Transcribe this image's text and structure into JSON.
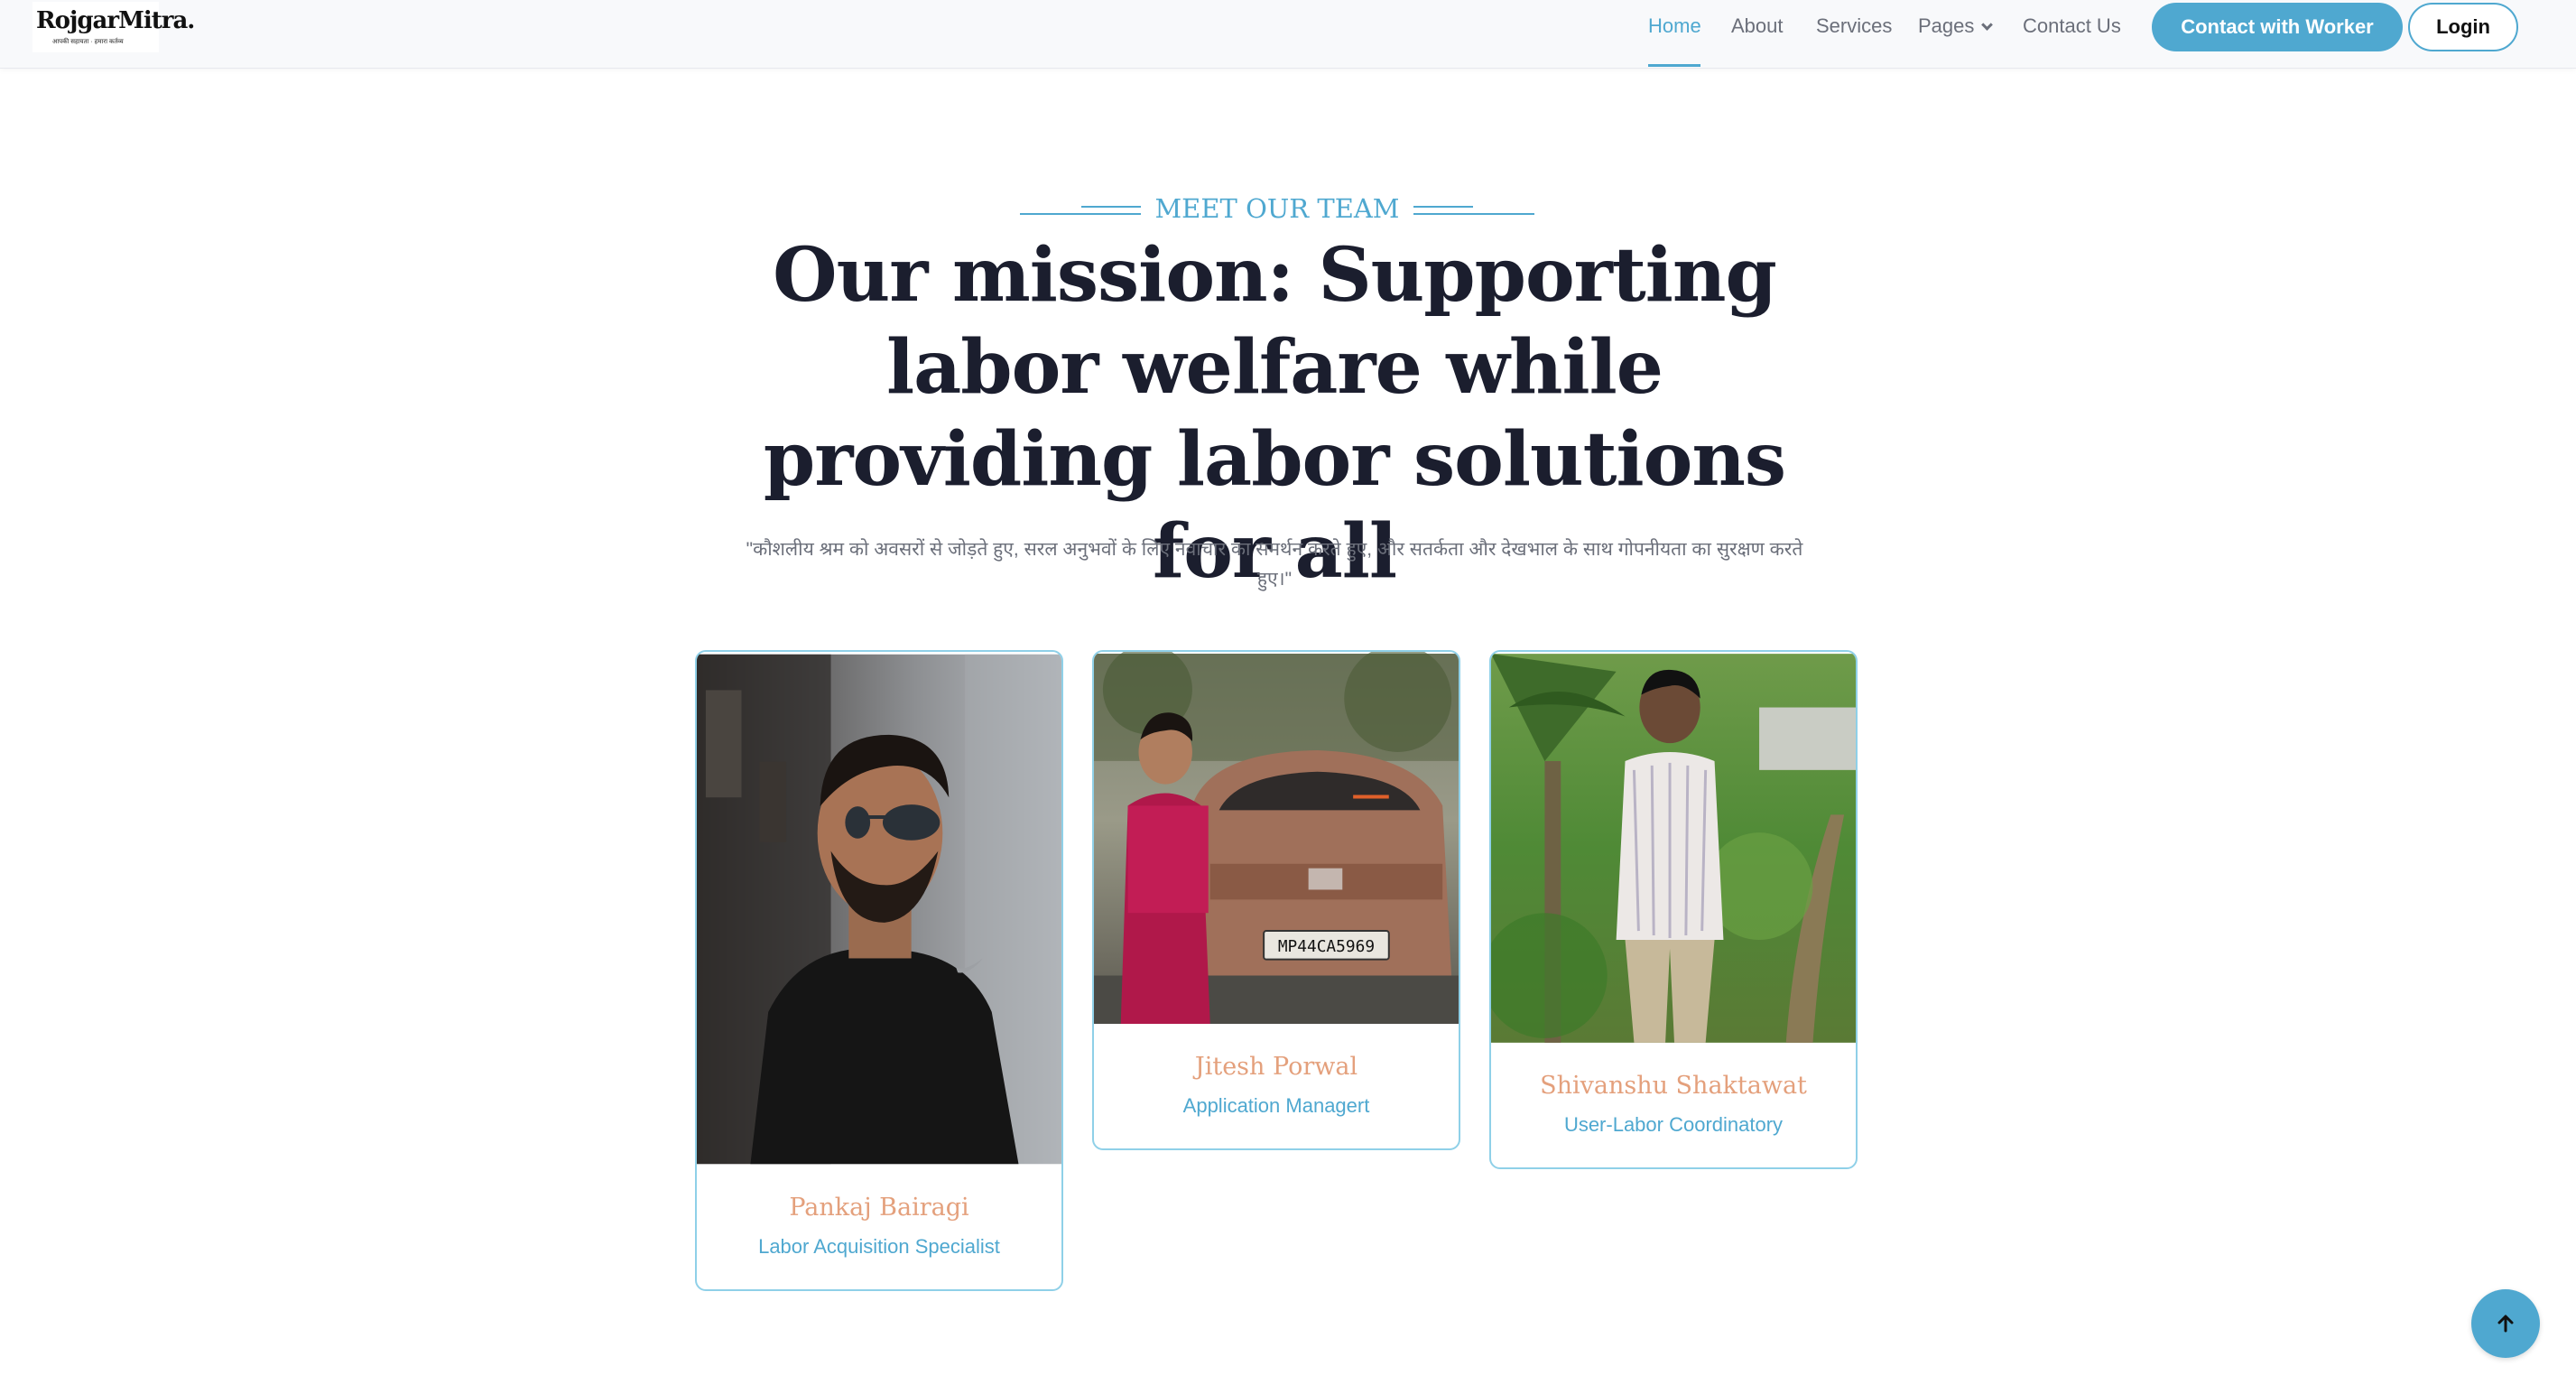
{
  "logo": {
    "title": "RojgarMitra.",
    "tagline": "आपकी सहायता · हमारा कर्तव्य"
  },
  "nav": {
    "items": [
      {
        "label": "Home",
        "active": true
      },
      {
        "label": "About",
        "active": false
      },
      {
        "label": "Services",
        "active": false
      },
      {
        "label": "Pages",
        "active": false
      },
      {
        "label": "Contact Us",
        "active": false
      }
    ],
    "contact_button": "Contact with Worker",
    "login_button": "Login"
  },
  "hero": {
    "eyebrow": "MEET OUR TEAM",
    "headline": "Our mission: Supporting labor welfare while providing labor solutions for all",
    "subtext": "\"कौशलीय श्रम को अवसरों से जोड़ते हुए, सरल अनुभवों के लिए नवाचार का समर्थन करते हुए, और सतर्कता और देखभाल के साथ गोपनीयता का सुरक्षण करते हुए।\""
  },
  "team": [
    {
      "name": "Pankaj Bairagi",
      "role": "Labor Acquisition Specialist"
    },
    {
      "name": "Jitesh Porwal",
      "role": "Application Managert"
    },
    {
      "name": "Shivanshu Shaktawat",
      "role": "User-Labor Coordinatory"
    }
  ],
  "photos": {
    "card1": "man-in-black-tshirt-sunglasses-photo",
    "card2": "man-in-red-kurta-with-car-photo",
    "card3": "man-in-striped-shirt-palm-field-photo",
    "plate": "MP44CA5969"
  },
  "colors": {
    "accent": "#4fa8d0",
    "name_color": "#e4a07c",
    "heading": "#1b1e2e",
    "muted": "#6b6f7a"
  },
  "icons": {
    "back_to_top": "arrow-up-icon",
    "pages_dropdown": "chevron-down-icon"
  }
}
